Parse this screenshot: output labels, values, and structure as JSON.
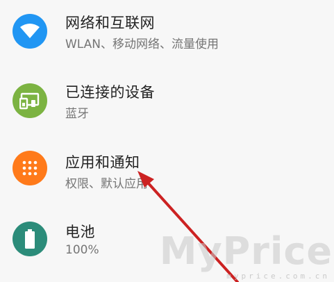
{
  "settings": {
    "items": [
      {
        "title": "网络和互联网",
        "subtitle": "WLAN、移动网络、流量使用",
        "icon": "wifi-icon",
        "color": "#2196f3"
      },
      {
        "title": "已连接的设备",
        "subtitle": "蓝牙",
        "icon": "connected-devices-icon",
        "color": "#7cb342"
      },
      {
        "title": "应用和通知",
        "subtitle": "权限、默认应用",
        "icon": "apps-grid-icon",
        "color": "#ff7a1a"
      },
      {
        "title": "电池",
        "subtitle": "100%",
        "icon": "battery-icon",
        "color": "#2c8c7a"
      }
    ]
  },
  "watermark": {
    "brand": "MyPrice",
    "url": "myprice.com.cn"
  },
  "annotation": {
    "arrow_color": "#cc2222"
  }
}
